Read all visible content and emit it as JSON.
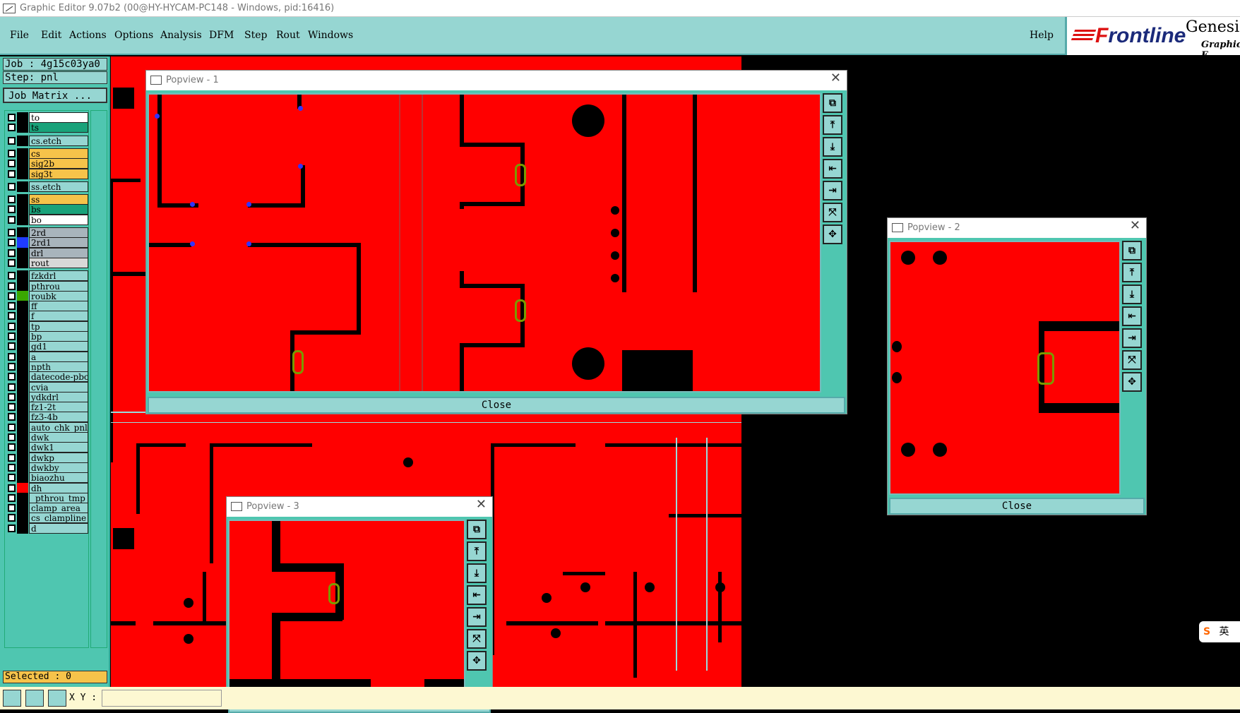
{
  "window": {
    "title": "Graphic Editor 9.07b2 (00@HY-HYCAM-PC148 - Windows, pid:16416)"
  },
  "menu": {
    "items": [
      "File",
      "Edit",
      "Actions",
      "Options",
      "Analysis",
      "DFM",
      "Step",
      "Rout",
      "Windows"
    ],
    "help": "Help"
  },
  "logo": {
    "brand_prefix": "F",
    "brand_rest": "rontline",
    "product": "Genesis",
    "edition": "Graphic E"
  },
  "job": {
    "job_label": "Job : 4g15c03ya0",
    "step_label": "Step: pnl",
    "matrix_button": "Job Matrix ..."
  },
  "layers": [
    {
      "name": "to",
      "color": "#ffffff",
      "swatch": "#000000"
    },
    {
      "name": "ts",
      "color": "#19a27a",
      "swatch": "#000000"
    },
    {
      "name": "cs.etch",
      "color": "#96d6d2",
      "swatch": "#000000"
    },
    {
      "name": "cs",
      "color": "#f6c34a",
      "swatch": "#000000"
    },
    {
      "name": "sig2b",
      "color": "#f6c34a",
      "swatch": "#000000"
    },
    {
      "name": "sig3t",
      "color": "#f6c34a",
      "swatch": "#000000"
    },
    {
      "name": "ss.etch",
      "color": "#96d6d2",
      "swatch": "#000000"
    },
    {
      "name": "ss",
      "color": "#f6c34a",
      "swatch": "#000000"
    },
    {
      "name": "bs",
      "color": "#19a27a",
      "swatch": "#000000"
    },
    {
      "name": "bo",
      "color": "#ffffff",
      "swatch": "#000000"
    },
    {
      "name": "2rd",
      "color": "#a8b4bc",
      "swatch": "#000000"
    },
    {
      "name": "2rd1",
      "color": "#a8b4bc",
      "swatch": "#1f3bff"
    },
    {
      "name": "drl",
      "color": "#a8b4bc",
      "swatch": "#000000"
    },
    {
      "name": "rout",
      "color": "#d8d8d8",
      "swatch": "#000000"
    },
    {
      "name": "fzkdrl",
      "color": "#96d6d2",
      "swatch": "#000000"
    },
    {
      "name": "pthrou",
      "color": "#96d6d2",
      "swatch": "#000000"
    },
    {
      "name": "roubk",
      "color": "#96d6d2",
      "swatch": "#3aa800"
    },
    {
      "name": "ff",
      "color": "#96d6d2",
      "swatch": "#000000"
    },
    {
      "name": "f",
      "color": "#96d6d2",
      "swatch": "#000000"
    },
    {
      "name": "tp",
      "color": "#96d6d2",
      "swatch": "#000000"
    },
    {
      "name": "bp",
      "color": "#96d6d2",
      "swatch": "#000000"
    },
    {
      "name": "gd1",
      "color": "#96d6d2",
      "swatch": "#000000"
    },
    {
      "name": "a",
      "color": "#96d6d2",
      "swatch": "#000000"
    },
    {
      "name": "npth",
      "color": "#96d6d2",
      "swatch": "#000000"
    },
    {
      "name": "datecode-pbc",
      "color": "#96d6d2",
      "swatch": "#000000"
    },
    {
      "name": "cvia",
      "color": "#96d6d2",
      "swatch": "#000000"
    },
    {
      "name": "ydkdrl",
      "color": "#96d6d2",
      "swatch": "#000000"
    },
    {
      "name": "fz1-2t",
      "color": "#96d6d2",
      "swatch": "#000000"
    },
    {
      "name": "fz3-4b",
      "color": "#96d6d2",
      "swatch": "#000000"
    },
    {
      "name": "auto_chk_pnl",
      "color": "#96d6d2",
      "swatch": "#000000"
    },
    {
      "name": "dwk",
      "color": "#96d6d2",
      "swatch": "#000000"
    },
    {
      "name": "dwk1",
      "color": "#96d6d2",
      "swatch": "#000000"
    },
    {
      "name": "dwkp",
      "color": "#96d6d2",
      "swatch": "#000000"
    },
    {
      "name": "dwkby",
      "color": "#96d6d2",
      "swatch": "#000000"
    },
    {
      "name": "biaozhu",
      "color": "#96d6d2",
      "swatch": "#000000"
    },
    {
      "name": "dh",
      "color": "#96d6d2",
      "swatch": "#ff0000"
    },
    {
      "name": "_pthrou_tmp",
      "color": "#96d6d2",
      "swatch": "#000000"
    },
    {
      "name": "clamp_area",
      "color": "#96d6d2",
      "swatch": "#000000"
    },
    {
      "name": "cs_clampline",
      "color": "#96d6d2",
      "swatch": "#000000"
    },
    {
      "name": "d",
      "color": "#96d6d2",
      "swatch": "#000000"
    }
  ],
  "status": {
    "selected": "Selected : 0",
    "xy_label": "X Y :",
    "xy_value": ""
  },
  "popups": [
    {
      "title": "Popview - 1",
      "close_label": "Close"
    },
    {
      "title": "Popview - 2",
      "close_label": "Close"
    },
    {
      "title": "Popview - 3",
      "close_label": "Close"
    }
  ],
  "popup_buttons": [
    "zoom-window-icon",
    "pan-up-icon",
    "pan-down-icon",
    "pan-left-icon",
    "pan-right-icon",
    "zoom-in-icon",
    "zoom-out-icon"
  ],
  "ime": {
    "label": "英"
  },
  "colors": {
    "board": "#ff0000",
    "copper": "#000000",
    "panel": "#4fc6b0",
    "button": "#96d6d2"
  }
}
